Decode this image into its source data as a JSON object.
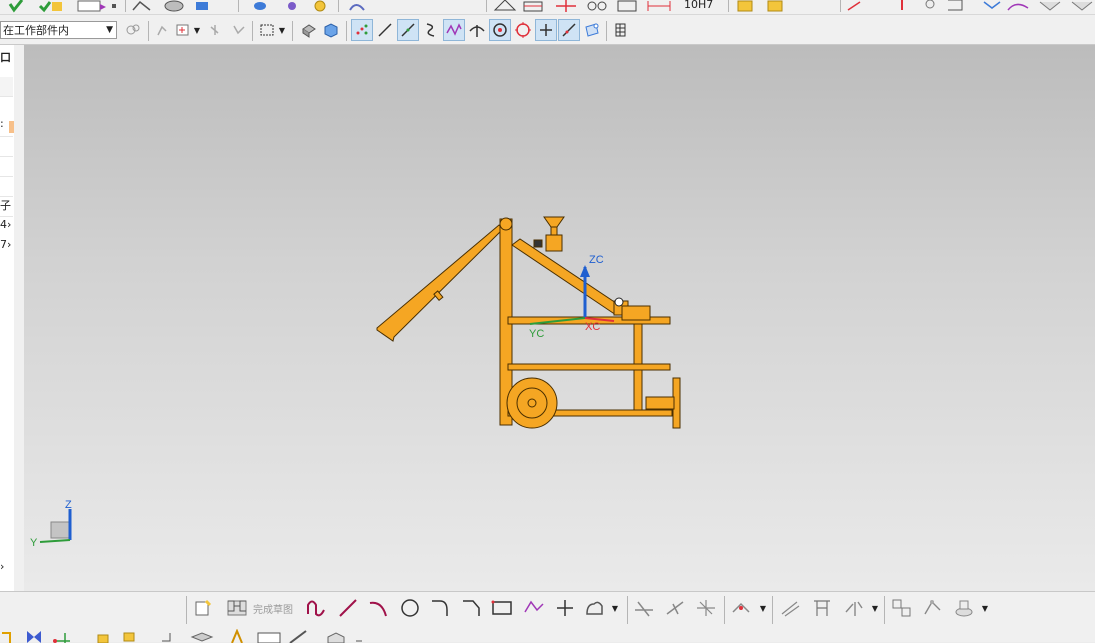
{
  "toolbar": {
    "top_row_text": "10H7",
    "work_part_select": {
      "value": "在工作部件内"
    }
  },
  "left_panel": {
    "rows": [
      {
        "text": "口"
      },
      {
        "text": ""
      },
      {
        "text": ":"
      },
      {
        "text": ""
      },
      {
        "text": ""
      },
      {
        "text": ""
      },
      {
        "text": ""
      },
      {
        "text": "子"
      },
      {
        "text": "4›"
      },
      {
        "text": "7›"
      }
    ],
    "collapse_glyph": "›"
  },
  "viewport": {
    "wcs_labels": {
      "z": "ZC",
      "y": "YC",
      "x": "XC"
    },
    "triad_labels": {
      "z": "Z",
      "y": "Y"
    },
    "model_color": "#f5a623"
  },
  "sketch_toolbar": {
    "finish_sketch_label": "完成草图"
  },
  "colors": {
    "accent_blue": "#1f5fd0",
    "axis_red": "#e0303a",
    "axis_green": "#2e9c3a"
  }
}
